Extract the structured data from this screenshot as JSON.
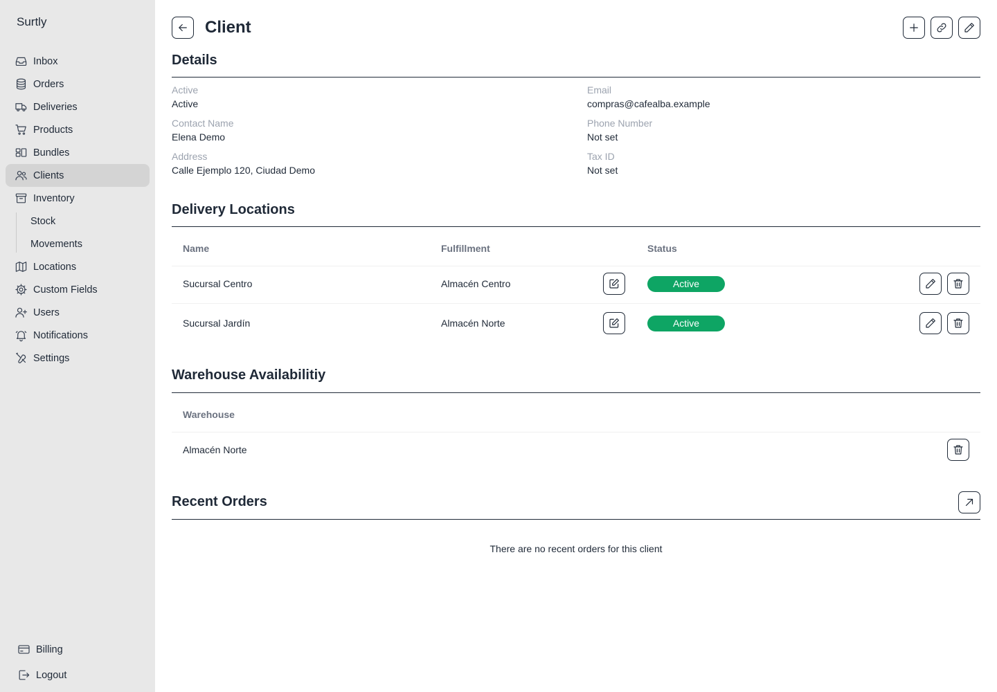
{
  "app": {
    "name": "Surtly"
  },
  "sidebar": {
    "items": [
      {
        "label": "Inbox",
        "icon": "inbox-icon"
      },
      {
        "label": "Orders",
        "icon": "database-icon"
      },
      {
        "label": "Deliveries",
        "icon": "truck-icon"
      },
      {
        "label": "Products",
        "icon": "cart-icon"
      },
      {
        "label": "Bundles",
        "icon": "bundle-icon"
      },
      {
        "label": "Clients",
        "icon": "users-icon",
        "active": true
      },
      {
        "label": "Inventory",
        "icon": "archive-icon"
      }
    ],
    "inventory_sub": [
      {
        "label": "Stock"
      },
      {
        "label": "Movements"
      }
    ],
    "items_after": [
      {
        "label": "Locations",
        "icon": "map-icon"
      },
      {
        "label": "Custom Fields",
        "icon": "cog-icon"
      },
      {
        "label": "Users",
        "icon": "user-plus-icon"
      },
      {
        "label": "Notifications",
        "icon": "bell-icon"
      },
      {
        "label": "Settings",
        "icon": "tools-icon"
      }
    ],
    "bottom": [
      {
        "label": "Billing",
        "icon": "credit-card-icon"
      },
      {
        "label": "Logout",
        "icon": "logout-icon"
      }
    ]
  },
  "header": {
    "title": "Client"
  },
  "details": {
    "title": "Details",
    "fields": {
      "active": {
        "label": "Active",
        "value": "Active"
      },
      "email": {
        "label": "Email",
        "value": "compras@cafealba.example"
      },
      "contact": {
        "label": "Contact Name",
        "value": "Elena Demo"
      },
      "phone": {
        "label": "Phone Number",
        "value": "Not set"
      },
      "address": {
        "label": "Address",
        "value": "Calle Ejemplo 120, Ciudad Demo"
      },
      "tax": {
        "label": "Tax ID",
        "value": "Not set"
      }
    }
  },
  "delivery_locations": {
    "title": "Delivery Locations",
    "columns": {
      "name": "Name",
      "fulfillment": "Fulfillment",
      "status": "Status"
    },
    "rows": [
      {
        "name": "Sucursal Centro",
        "fulfillment": "Almacén Centro",
        "status": "Active"
      },
      {
        "name": "Sucursal Jardín",
        "fulfillment": "Almacén Norte",
        "status": "Active"
      }
    ]
  },
  "warehouse": {
    "title": "Warehouse Availabilitiy",
    "column": "Warehouse",
    "rows": [
      {
        "name": "Almacén Norte"
      }
    ]
  },
  "recent_orders": {
    "title": "Recent Orders",
    "empty": "There are no recent orders for this client"
  },
  "colors": {
    "status_active": "#0ea564",
    "sidebar_bg": "#e8e8e8",
    "sidebar_active": "#d4d4d4"
  }
}
